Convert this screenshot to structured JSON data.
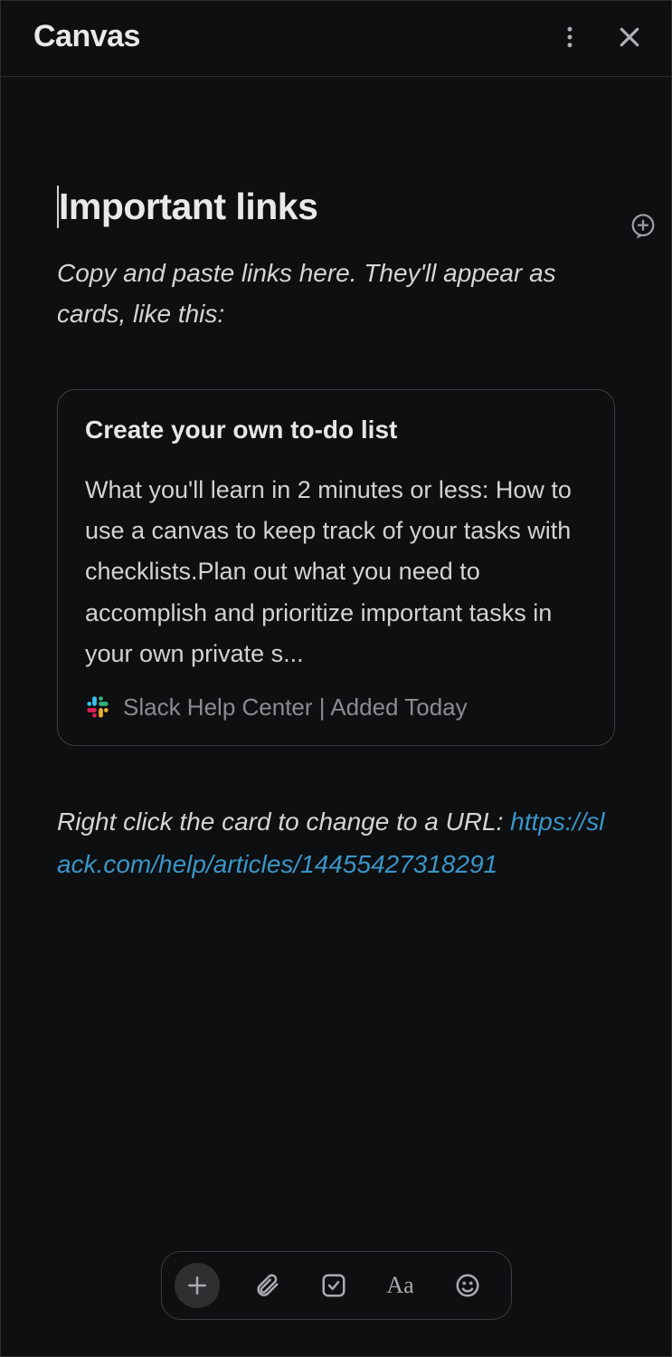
{
  "header": {
    "title": "Canvas"
  },
  "doc": {
    "title": "Important links",
    "instruction": "Copy and paste links here. They'll appear as cards, like this:"
  },
  "card": {
    "title": "Create your own to-do list",
    "body": " What you'll learn in 2 minutes or less: How to use a canvas to keep track of your tasks with checklists.Plan out what you need to accomplish and prioritize important tasks in your own private s...",
    "source": "Slack Help Center | Added Today"
  },
  "post": {
    "text": "Right click the card to change to a URL:",
    "url": "https://slack.com/help/articles/14455427318291"
  },
  "toolbar": {
    "format": "Aa"
  }
}
